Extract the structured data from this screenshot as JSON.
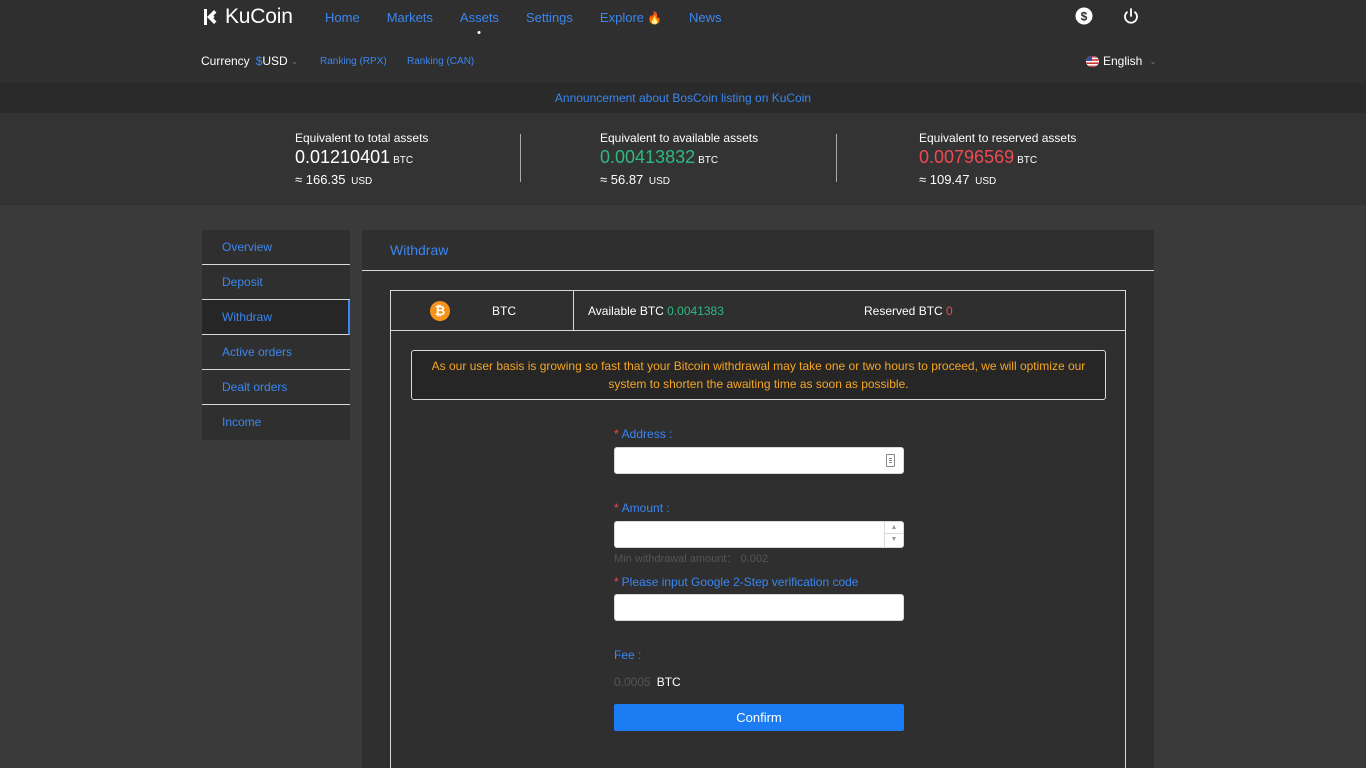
{
  "brand": {
    "name": "KuCoin"
  },
  "nav": {
    "items": [
      {
        "label": "Home"
      },
      {
        "label": "Markets"
      },
      {
        "label": "Assets"
      },
      {
        "label": "Settings"
      },
      {
        "label": "Explore"
      },
      {
        "label": "News"
      }
    ],
    "active": "Assets"
  },
  "subbar": {
    "currency_label": "Currency",
    "currency_symbol": "$",
    "currency_value": "USD",
    "ranking_rpx": "Ranking (RPX)",
    "ranking_can": "Ranking (CAN)",
    "language": "English"
  },
  "announcement": "Announcement about BosCoin listing on KuCoin",
  "summary": {
    "total": {
      "label": "Equivalent to total assets",
      "btc": "0.01210401",
      "unit": "BTC",
      "usd": "≈ 166.35",
      "usd_unit": "USD"
    },
    "available": {
      "label": "Equivalent to available assets",
      "btc": "0.00413832",
      "unit": "BTC",
      "usd": "≈ 56.87",
      "usd_unit": "USD"
    },
    "reserved": {
      "label": "Equivalent to reserved assets",
      "btc": "0.00796569",
      "unit": "BTC",
      "usd": "≈ 109.47",
      "usd_unit": "USD"
    }
  },
  "sidebar": {
    "items": [
      {
        "label": "Overview"
      },
      {
        "label": "Deposit"
      },
      {
        "label": "Withdraw"
      },
      {
        "label": "Active orders"
      },
      {
        "label": "Dealt orders"
      },
      {
        "label": "Income"
      }
    ],
    "active": "Withdraw"
  },
  "withdraw": {
    "title": "Withdraw",
    "coin": "BTC",
    "coin_icon": "bitcoin-icon",
    "available_label": "Available BTC",
    "available_value": "0.0041383",
    "reserved_label": "Reserved BTC",
    "reserved_value": "0",
    "notice": "As our user basis is growing so fast that your Bitcoin withdrawal may take one or two hours to proceed, we will optimize our system to shorten the awaiting time as soon as possible.",
    "address_label": "Address :",
    "address_value": "",
    "amount_label": "Amount :",
    "amount_value": "",
    "min_hint": "Min withdrawal amount： 0.002",
    "google_label": "Please input Google 2-Step verification code",
    "google_value": "",
    "fee_label": "Fee :",
    "fee_value": "0.0005",
    "fee_unit": "BTC",
    "confirm_label": "Confirm"
  },
  "colors": {
    "accent": "#3b86f0",
    "positive": "#2eb982",
    "negative": "#ef4a54",
    "warning": "#f5a623",
    "button": "#1b7cf3"
  }
}
